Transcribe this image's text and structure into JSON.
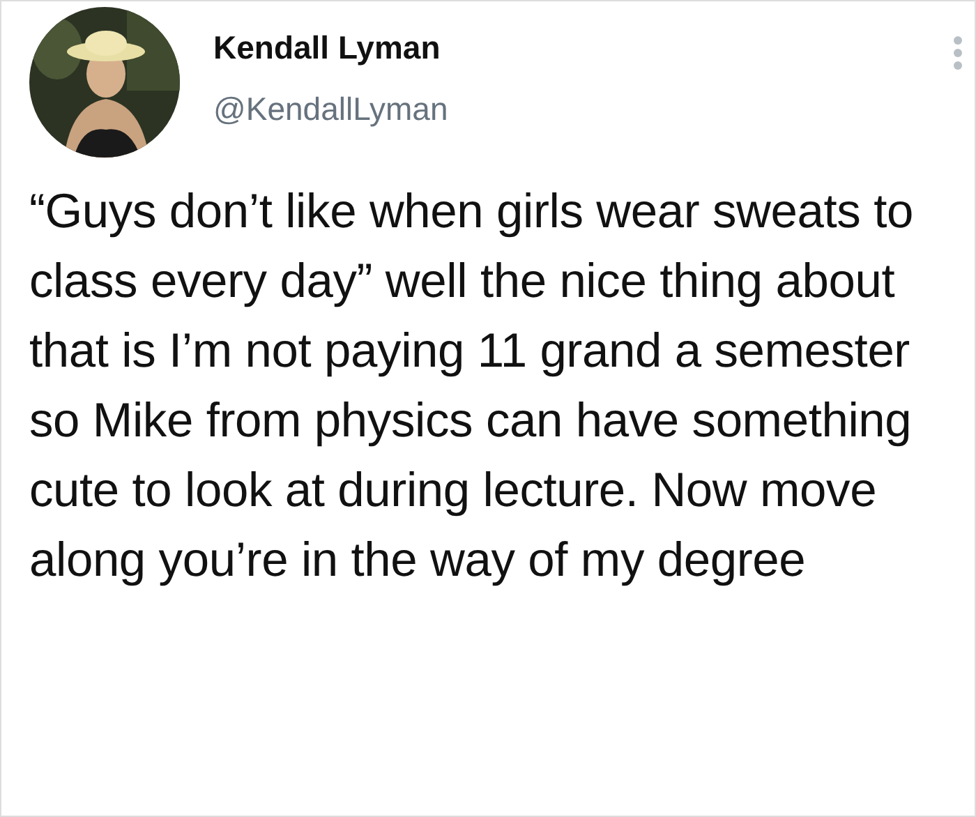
{
  "author": {
    "name": "Kendall Lyman",
    "handle": "@KendallLyman"
  },
  "tweet": {
    "text": "“Guys don’t like when girls wear sweats to class every day” well the nice thing about that is I’m not paying 11 grand a semester so Mike from physics can have something cute to look at during lecture. Now move along you’re in the way of my degree"
  }
}
